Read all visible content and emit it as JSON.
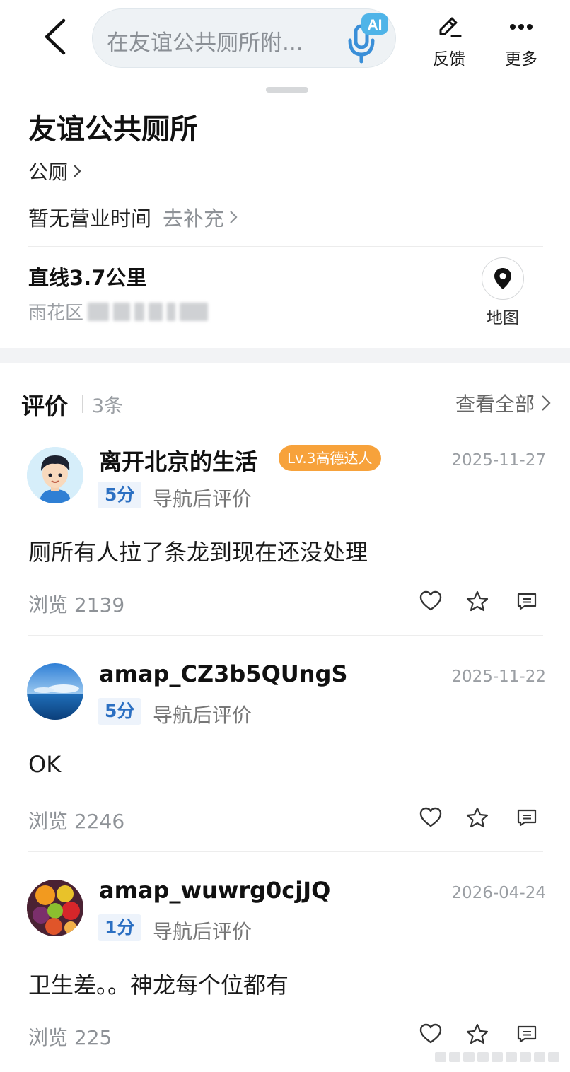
{
  "search": {
    "placeholder": "在友谊公共厕所附..."
  },
  "topbar": {
    "ai_badge": "AI",
    "feedback_label": "反馈",
    "more_label": "更多"
  },
  "poi": {
    "title": "友谊公共厕所",
    "category": "公厕",
    "hours_text": "暂无营业时间",
    "hours_link": "去补充",
    "distance": "直线3.7公里",
    "address_visible": "雨花区",
    "map_label": "地图"
  },
  "reviews_header": {
    "title": "评价",
    "count": "3条",
    "view_all": "查看全部"
  },
  "reviews": [
    {
      "user": "离开北京的生活",
      "badge": "Lv.3高德达人",
      "date": "2025-11-27",
      "score": "5分",
      "score_note": "导航后评价",
      "content": "厕所有人拉了条龙到现在还没处理",
      "views": "浏览 2139"
    },
    {
      "user": "amap_CZ3b5QUngS",
      "badge": "",
      "date": "2025-11-22",
      "score": "5分",
      "score_note": "导航后评价",
      "content": "OK",
      "views": "浏览 2246"
    },
    {
      "user": "amap_wuwrg0cjJQ",
      "badge": "",
      "date": "2026-04-24",
      "score": "1分",
      "score_note": "导航后评价",
      "content": "卫生差。。神龙每个位都有",
      "views": "浏览 225"
    }
  ],
  "colors": {
    "accent_blue": "#2b6fc2",
    "badge_orange": "#f7a23b",
    "muted_text": "#9a9ea3"
  }
}
